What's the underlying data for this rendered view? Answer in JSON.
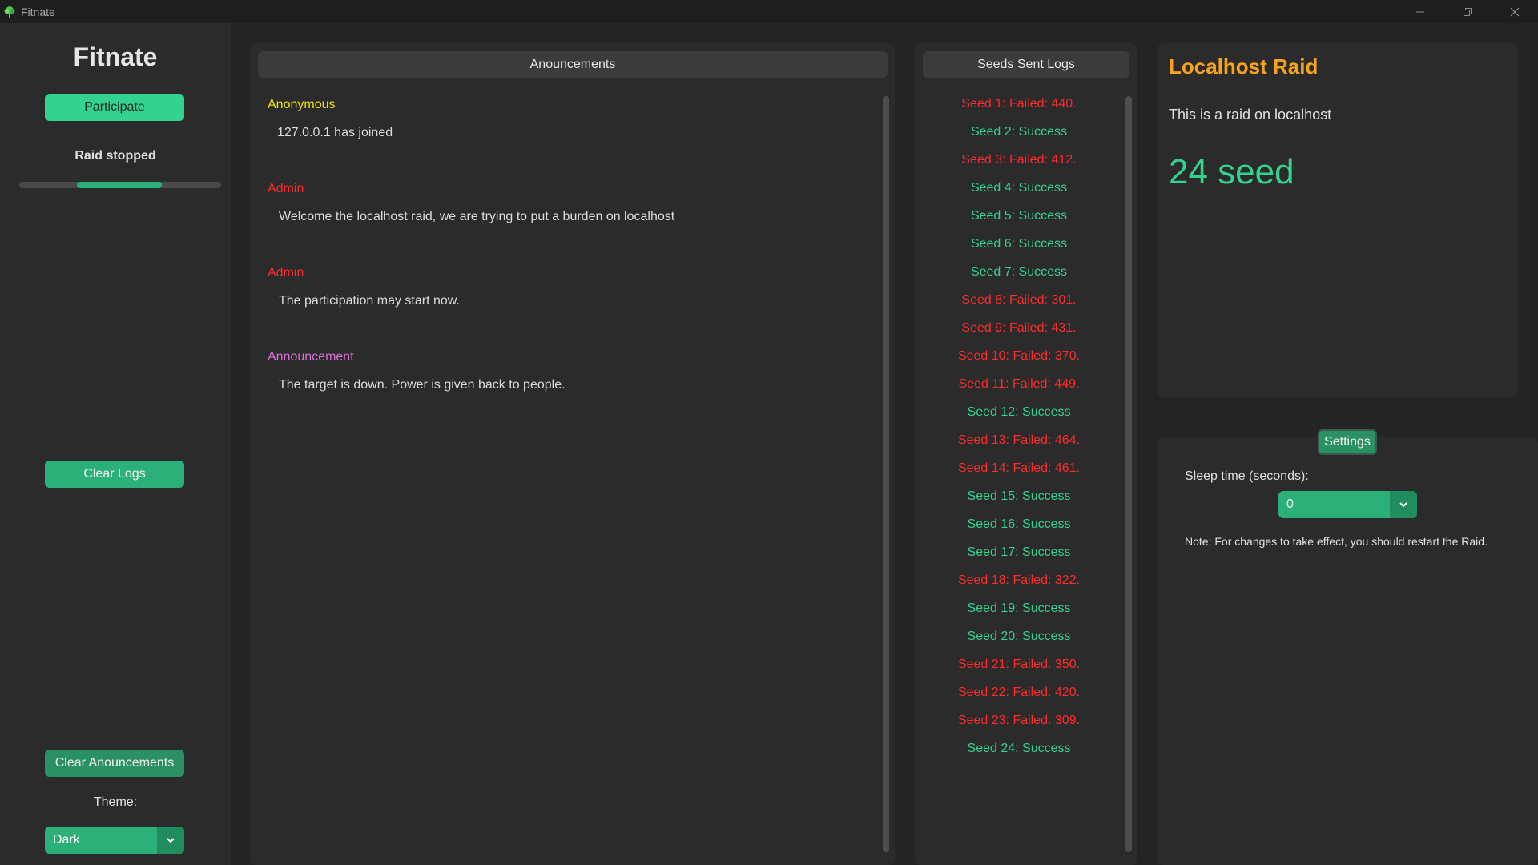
{
  "window": {
    "title": "Fitnate"
  },
  "sidebar": {
    "app_name": "Fitnate",
    "participate_label": "Participate",
    "raid_status": "Raid stopped",
    "progress_fraction": 0.42,
    "clear_logs_label": "Clear Logs",
    "clear_announcements_label": "Clear Anouncements",
    "theme_label": "Theme:",
    "theme_value": "Dark"
  },
  "announcements": {
    "header": "Anouncements",
    "items": [
      {
        "author": "Anonymous",
        "author_color": "#f0e400",
        "text": "127.0.0.1 has joined"
      },
      {
        "author": "Admin",
        "author_color": "#ff2a2a",
        "text": "Welcome the localhost raid, we are trying to put a burden on localhost"
      },
      {
        "author": "Admin",
        "author_color": "#ff2a2a",
        "text": "The participation may start now."
      },
      {
        "author": "Announcement",
        "author_color": "#da70d6",
        "text": "The target is down. Power is given back to people."
      }
    ]
  },
  "logs": {
    "header": "Seeds Sent Logs",
    "success_color": "#34d28f",
    "failed_color": "#ff2a2a",
    "entries": [
      {
        "text": "Seed 1: Failed: 440.",
        "ok": false
      },
      {
        "text": "Seed 2: Success",
        "ok": true
      },
      {
        "text": "Seed 3: Failed: 412.",
        "ok": false
      },
      {
        "text": "Seed 4: Success",
        "ok": true
      },
      {
        "text": "Seed 5: Success",
        "ok": true
      },
      {
        "text": "Seed 6: Success",
        "ok": true
      },
      {
        "text": "Seed 7: Success",
        "ok": true
      },
      {
        "text": "Seed 8: Failed: 301.",
        "ok": false
      },
      {
        "text": "Seed 9: Failed: 431.",
        "ok": false
      },
      {
        "text": "Seed 10: Failed: 370.",
        "ok": false
      },
      {
        "text": "Seed 11: Failed: 449.",
        "ok": false
      },
      {
        "text": "Seed 12: Success",
        "ok": true
      },
      {
        "text": "Seed 13: Failed: 464.",
        "ok": false
      },
      {
        "text": "Seed 14: Failed: 461.",
        "ok": false
      },
      {
        "text": "Seed 15: Success",
        "ok": true
      },
      {
        "text": "Seed 16: Success",
        "ok": true
      },
      {
        "text": "Seed 17: Success",
        "ok": true
      },
      {
        "text": "Seed 18: Failed: 322.",
        "ok": false
      },
      {
        "text": "Seed 19: Success",
        "ok": true
      },
      {
        "text": "Seed 20: Success",
        "ok": true
      },
      {
        "text": "Seed 21: Failed: 350.",
        "ok": false
      },
      {
        "text": "Seed 22: Failed: 420.",
        "ok": false
      },
      {
        "text": "Seed 23: Failed: 309.",
        "ok": false
      },
      {
        "text": "Seed 24: Success",
        "ok": true
      }
    ]
  },
  "raid": {
    "title": "Localhost Raid",
    "description": "This is a raid on localhost",
    "seed_count": "24 seed"
  },
  "settings": {
    "button_label": "Settings",
    "sleep_label": "Sleep time (seconds):",
    "sleep_value": "0",
    "note": "Note: For changes to take effect, you should restart the Raid."
  },
  "icons": {
    "app": "tree-icon",
    "minimize": "minimize-icon",
    "maximize": "restore-icon",
    "close": "close-icon",
    "dropdown": "chevron-down-icon"
  }
}
